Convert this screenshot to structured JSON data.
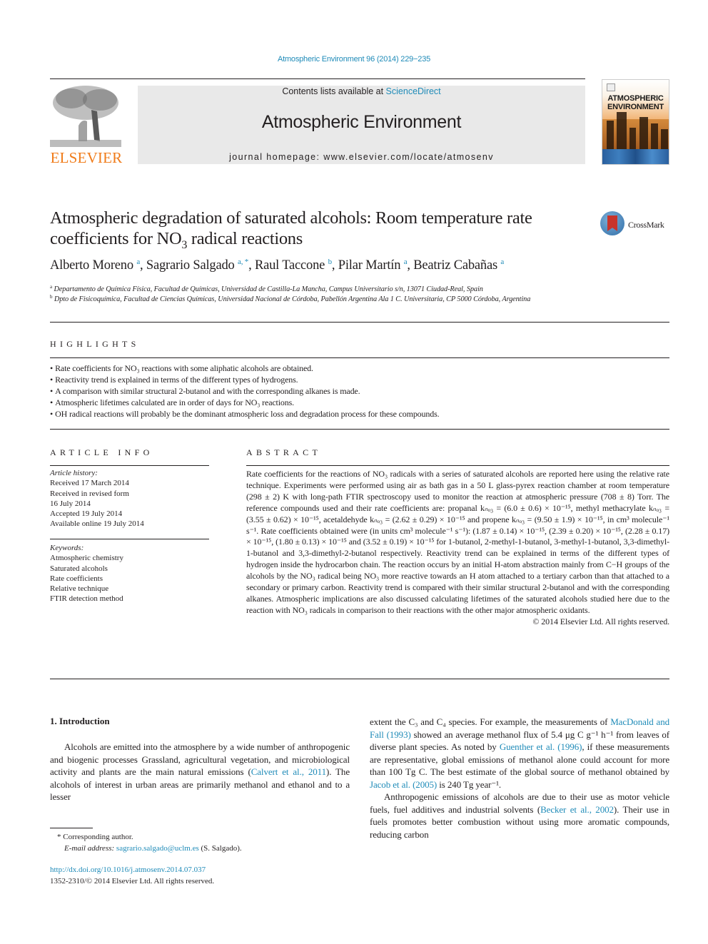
{
  "header": {
    "journal_reference": "Atmospheric Environment 96 (2014) 229−235",
    "contents_prefix": "Contents lists available at ",
    "contents_link": "ScienceDirect",
    "journal_name": "Atmospheric Environment",
    "homepage": "journal homepage: www.elsevier.com/locate/atmosenv",
    "publisher_logo_text": "ELSEVIER",
    "cover_title_line1": "ATMOSPHERIC",
    "cover_title_line2": "ENVIRONMENT",
    "crossmark_label": "CrossMark",
    "colors": {
      "link": "#1f8bb8",
      "elsevier_orange": "#f07b19",
      "header_bg": "#e9e9e9"
    }
  },
  "article": {
    "title_part1": "Atmospheric degradation of saturated alcohols: Room temperature rate coefficients for NO",
    "title_sub": "3",
    "title_part2": " radical reactions",
    "authors": [
      {
        "name": "Alberto Moreno",
        "aff": "a"
      },
      {
        "name": "Sagrario Salgado",
        "aff": "a, *"
      },
      {
        "name": "Raul Taccone",
        "aff": "b"
      },
      {
        "name": "Pilar Martín",
        "aff": "a"
      },
      {
        "name": "Beatriz Cabañas",
        "aff": "a"
      }
    ],
    "affiliations": [
      {
        "mark": "a",
        "text": "Departamento de Química Física, Facultad de Químicas, Universidad de Castilla-La Mancha, Campus Universitario s/n, 13071 Ciudad-Real, Spain"
      },
      {
        "mark": "b",
        "text": "Dpto de Fisicoquímica, Facultad de Ciencias Químicas, Universidad Nacional de Córdoba, Pabellón Argentina Ala 1 C. Universitaria, CP 5000 Córdoba, Argentina"
      }
    ]
  },
  "highlights": {
    "heading": "HIGHLIGHTS",
    "items": [
      "Rate coefficients for NO₃ reactions with some aliphatic alcohols are obtained.",
      "Reactivity trend is explained in terms of the different types of hydrogens.",
      "A comparison with similar structural 2-butanol and with the corresponding alkanes is made.",
      "Atmospheric lifetimes calculated are in order of days for NO₃ reactions.",
      "OH radical reactions will probably be the dominant atmospheric loss and degradation process for these compounds."
    ]
  },
  "article_info": {
    "heading": "ARTICLE INFO",
    "history_label": "Article history:",
    "history": [
      "Received 17 March 2014",
      "Received in revised form",
      "16 July 2014",
      "Accepted 19 July 2014",
      "Available online 19 July 2014"
    ],
    "keywords_label": "Keywords:",
    "keywords": [
      "Atmospheric chemistry",
      "Saturated alcohols",
      "Rate coefficients",
      "Relative technique",
      "FTIR detection method"
    ]
  },
  "abstract": {
    "heading": "ABSTRACT",
    "text": "Rate coefficients for the reactions of NO₃ radicals with a series of saturated alcohols are reported here using the relative rate technique. Experiments were performed using air as bath gas in a 50 L glass-pyrex reaction chamber at room temperature (298 ± 2) K with long-path FTIR spectroscopy used to monitor the reaction at atmospheric pressure (708 ± 8) Torr. The reference compounds used and their rate coefficients are: propanal kₙₒ₃ = (6.0 ± 0.6) × 10⁻¹⁵, methyl methacrylate kₙₒ₃ = (3.55 ± 0.62) × 10⁻¹⁵, acetaldehyde kₙₒ₃ = (2.62 ± 0.29) × 10⁻¹⁵ and propene kₙₒ₃ = (9.50 ± 1.9) × 10⁻¹⁵, in cm³ molecule⁻¹ s⁻¹. Rate coefficients obtained were (in units cm³ molecule⁻¹ s⁻¹): (1.87 ± 0.14) × 10⁻¹⁵, (2.39 ± 0.20) × 10⁻¹⁵, (2.28 ± 0.17) × 10⁻¹⁵, (1.80 ± 0.13) × 10⁻¹⁵ and (3.52 ± 0.19) × 10⁻¹⁵ for 1-butanol, 2-methyl-1-butanol, 3-methyl-1-butanol, 3,3-dimethyl-1-butanol and 3,3-dimethyl-2-butanol respectively. Reactivity trend can be explained in terms of the different types of hydrogen inside the hydrocarbon chain. The reaction occurs by an initial H-atom abstraction mainly from C−H groups of the alcohols by the NO₃ radical being NO₃ more reactive towards an H atom attached to a tertiary carbon than that attached to a secondary or primary carbon. Reactivity trend is compared with their similar structural 2-butanol and with the corresponding alkanes. Atmospheric implications are also discussed calculating lifetimes of the saturated alcohols studied here due to the reaction with NO₃ radicals in comparison to their reactions with the other major atmospheric oxidants.",
    "copyright": "© 2014 Elsevier Ltd. All rights reserved."
  },
  "body": {
    "section_heading": "1.  Introduction",
    "col1_p1_a": "Alcohols are emitted into the atmosphere by a wide number of anthropogenic and biogenic processes Grassland, agricultural vegetation, and microbiological activity and plants are the main natural emissions (",
    "col1_ref1": "Calvert et al., 2011",
    "col1_p1_b": "). The alcohols of interest in urban areas are primarily methanol and ethanol and to a lesser",
    "col2_p1_a": "extent the C₃ and C₄ species. For example, the measurements of ",
    "col2_ref1": "MacDonald and Fall (1993)",
    "col2_p1_b": " showed an average methanol flux of 5.4 μg C g⁻¹ h⁻¹ from leaves of diverse plant species. As noted by ",
    "col2_ref2": "Guenther et al. (1996)",
    "col2_p1_c": ", if these measurements are representative, global emissions of methanol alone could account for more than 100 Tg C. The best estimate of the global source of methanol obtained by ",
    "col2_ref3": "Jacob et al. (2005)",
    "col2_p1_d": " is 240 Tg year⁻¹.",
    "col2_p2_a": "Anthropogenic emissions of alcohols are due to their use as motor vehicle fuels, fuel additives and industrial solvents (",
    "col2_ref4": "Becker et al., 2002",
    "col2_p2_b": "). Their use in fuels promotes better combustion without using more aromatic compounds, reducing carbon"
  },
  "footnotes": {
    "corresponding": "* Corresponding author.",
    "email_label": "E-mail address: ",
    "email": "sagrario.salgado@uclm.es",
    "email_suffix": " (S. Salgado).",
    "doi": "http://dx.doi.org/10.1016/j.atmosenv.2014.07.037",
    "issn_line": "1352-2310/© 2014 Elsevier Ltd. All rights reserved."
  }
}
